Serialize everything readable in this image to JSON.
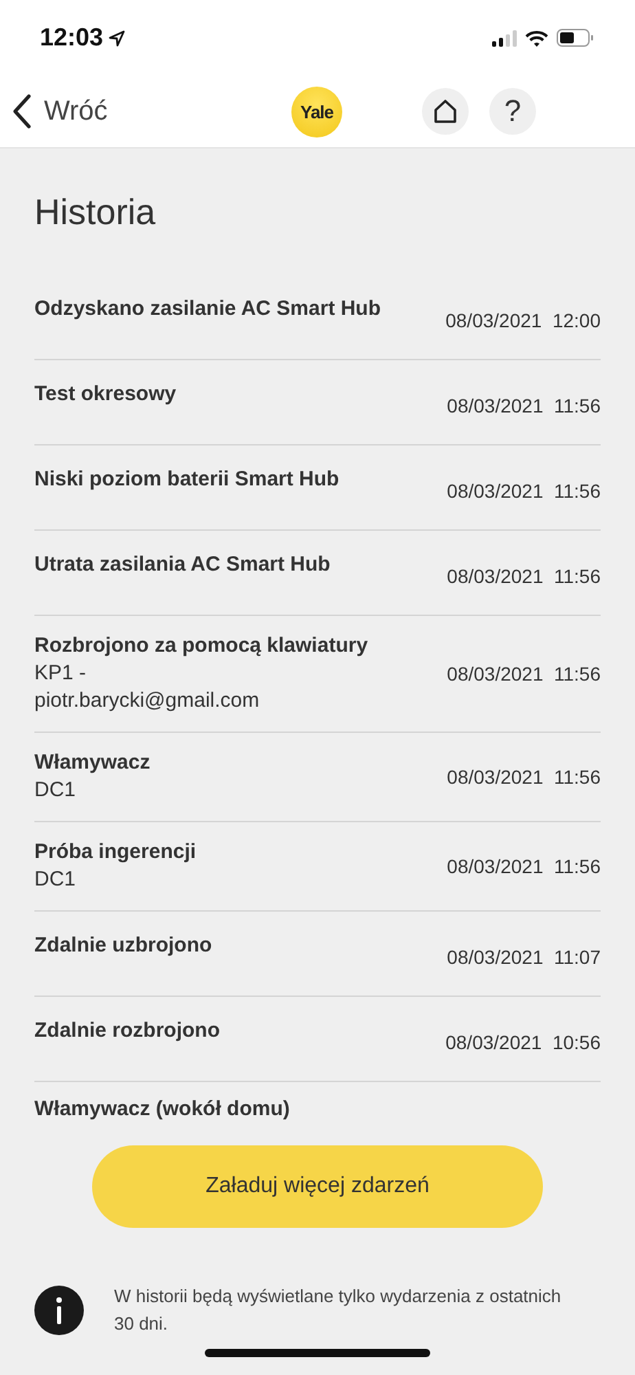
{
  "status_bar": {
    "time": "12:03"
  },
  "nav": {
    "back": "Wróć",
    "logo": "Yale",
    "help": "?"
  },
  "title": "Historia",
  "events": [
    {
      "title": "Odzyskano zasilanie AC Smart Hub",
      "date": "08/03/2021",
      "time": "12:00"
    },
    {
      "title": "Test okresowy",
      "date": "08/03/2021",
      "time": "11:56"
    },
    {
      "title": "Niski poziom baterii Smart Hub",
      "date": "08/03/2021",
      "time": "11:56"
    },
    {
      "title": "Utrata zasilania AC Smart Hub",
      "date": "08/03/2021",
      "time": "11:56"
    },
    {
      "title": "Rozbrojono za pomocą klawiatury",
      "details": [
        "KP1 -",
        "piotr.barycki@gmail.com"
      ],
      "date": "08/03/2021",
      "time": "11:56"
    },
    {
      "title": "Włamywacz",
      "details": [
        "DC1"
      ],
      "date": "08/03/2021",
      "time": "11:56"
    },
    {
      "title": "Próba ingerencji",
      "details": [
        "DC1"
      ],
      "date": "08/03/2021",
      "time": "11:56"
    },
    {
      "title": "Zdalnie uzbrojono",
      "date": "08/03/2021",
      "time": "11:07"
    },
    {
      "title": "Zdalnie rozbrojono",
      "date": "08/03/2021",
      "time": "10:56"
    },
    {
      "title": "Włamywacz (wokół domu)"
    }
  ],
  "load_more": "Załaduj więcej zdarzeń",
  "info": "W historii będą wyświetlane tylko wydarzenia z ostatnich 30 dni."
}
